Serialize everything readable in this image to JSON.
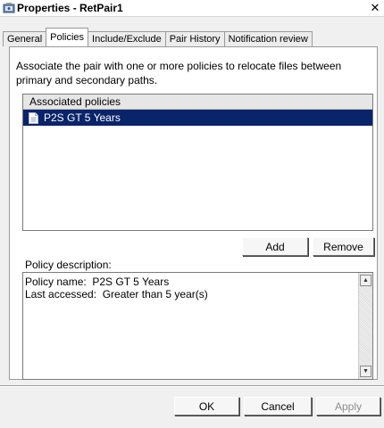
{
  "window": {
    "title": "Properties - RetPair1",
    "close_glyph": "✕",
    "icon": "properties-icon"
  },
  "tabs": [
    {
      "label": "General",
      "active": false
    },
    {
      "label": "Policies",
      "active": true
    },
    {
      "label": "Include/Exclude",
      "active": false
    },
    {
      "label": "Pair History",
      "active": false
    },
    {
      "label": "Notification review",
      "active": false
    }
  ],
  "policies": {
    "description": "Associate the pair with one or more policies to relocate files between primary and secondary paths.",
    "list_header": "Associated policies",
    "items": [
      {
        "label": "P2S GT 5 Years",
        "icon": "document-icon",
        "selected": true
      }
    ],
    "add_label": "Add",
    "remove_label": "Remove",
    "policy_description_label": "Policy description:",
    "policy_description_text": "Policy name:  P2S GT 5 Years\nLast accessed:  Greater than 5 year(s)"
  },
  "footer": {
    "ok_label": "OK",
    "cancel_label": "Cancel",
    "apply_label": "Apply"
  },
  "colors": {
    "selection": "#0a246a",
    "window_bg": "#f0f0f0",
    "panel_bg": "#ffffff"
  }
}
